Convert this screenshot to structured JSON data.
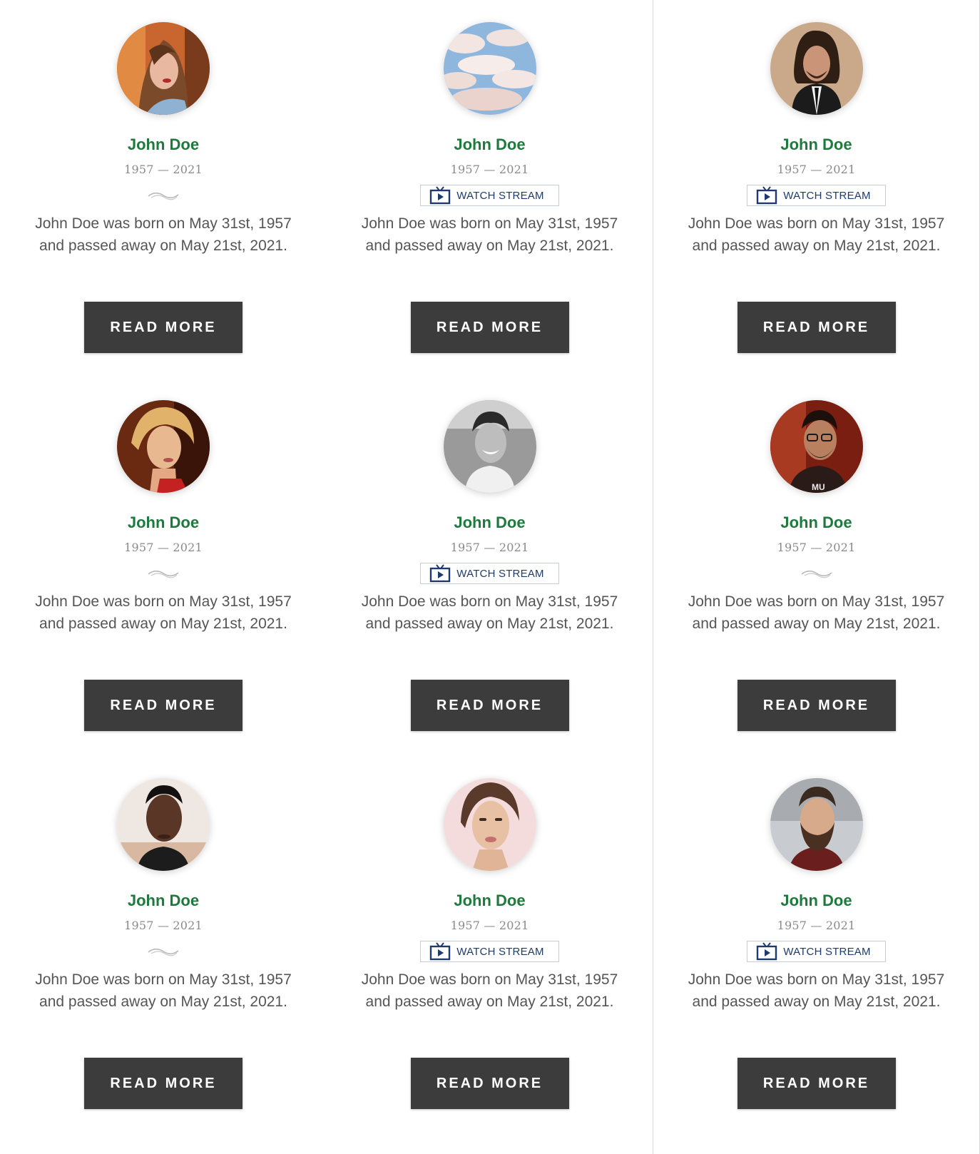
{
  "colors": {
    "name": "#1e7a3c",
    "years": "#8a8a8a",
    "description": "#555555",
    "button_bg": "#3c3c3c",
    "button_text": "#ffffff",
    "stream_text": "#1e3a6e",
    "divider": "#d6d6d6"
  },
  "cards": [
    {
      "photo_icon": "portrait-woman-long-hair",
      "name": "John Doe",
      "years": "1957 — 2021",
      "accessory": "ornament",
      "description_line1": "John Doe was born on May 31st, 1957",
      "description_line2": "and passed away on May 21st, 2021.",
      "read_more": "READ MORE"
    },
    {
      "photo_icon": "cloudy-sky",
      "name": "John Doe",
      "years": "1957 — 2021",
      "accessory": "watch-stream",
      "watch_stream": "WATCH STREAM",
      "description_line1": "John Doe was born on May 31st, 1957",
      "description_line2": "and passed away on May 21st, 2021.",
      "read_more": "READ MORE"
    },
    {
      "photo_icon": "portrait-man-suit",
      "name": "John Doe",
      "years": "1957 — 2021",
      "accessory": "watch-stream",
      "watch_stream": "WATCH STREAM",
      "description_line1": "John Doe was born on May 31st, 1957",
      "description_line2": "and passed away on May 21st, 2021.",
      "read_more": "READ MORE"
    },
    {
      "photo_icon": "portrait-woman-blonde",
      "name": "John Doe",
      "years": "1957 — 2021",
      "accessory": "ornament",
      "description_line1": "John Doe was born on May 31st, 1957",
      "description_line2": "and passed away on May 21st, 2021.",
      "read_more": "READ MORE"
    },
    {
      "photo_icon": "portrait-man-smiling-bw",
      "name": "John Doe",
      "years": "1957 — 2021",
      "accessory": "watch-stream",
      "watch_stream": "WATCH STREAM",
      "description_line1": "John Doe was born on May 31st, 1957",
      "description_line2": "and passed away on May 21st, 2021.",
      "read_more": "READ MORE"
    },
    {
      "photo_icon": "portrait-man-glasses",
      "name": "John Doe",
      "years": "1957 — 2021",
      "accessory": "ornament",
      "description_line1": "John Doe was born on May 31st, 1957",
      "description_line2": "and passed away on May 21st, 2021.",
      "read_more": "READ MORE"
    },
    {
      "photo_icon": "portrait-man-turtleneck",
      "name": "John Doe",
      "years": "1957 — 2021",
      "accessory": "ornament",
      "description_line1": "John Doe was born on May 31st, 1957",
      "description_line2": "and passed away on May 21st, 2021.",
      "read_more": "READ MORE"
    },
    {
      "photo_icon": "portrait-woman-short-hair",
      "name": "John Doe",
      "years": "1957 — 2021",
      "accessory": "watch-stream",
      "watch_stream": "WATCH STREAM",
      "description_line1": "John Doe was born on May 31st, 1957",
      "description_line2": "and passed away on May 21st, 2021.",
      "read_more": "READ MORE"
    },
    {
      "photo_icon": "portrait-man-beard",
      "name": "John Doe",
      "years": "1957 — 2021",
      "accessory": "watch-stream",
      "watch_stream": "WATCH STREAM",
      "description_line1": "John Doe was born on May 31st, 1957",
      "description_line2": "and passed away on May 21st, 2021.",
      "read_more": "READ MORE"
    }
  ]
}
